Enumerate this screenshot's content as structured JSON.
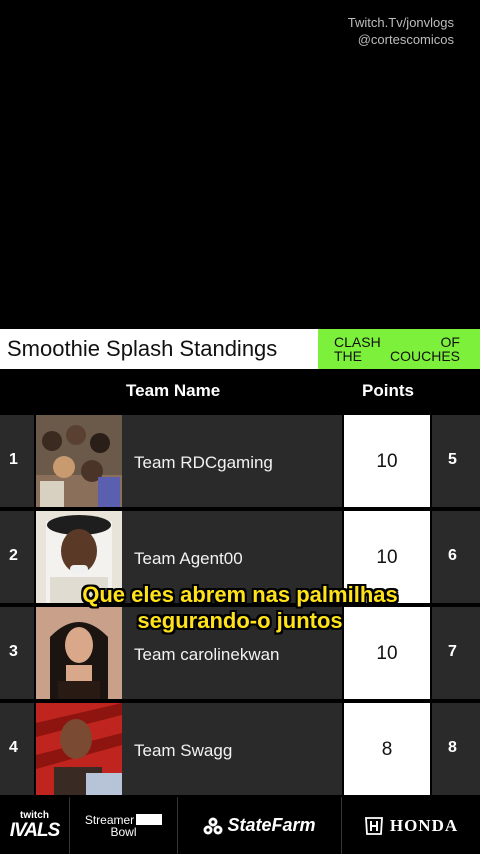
{
  "watermark": {
    "line1": "Twitch.Tv/jonvlogs",
    "line2": "@cortescomicos"
  },
  "header": {
    "title": "Smoothie Splash Standings",
    "badge": {
      "w1": "CLASH",
      "w2": "OF",
      "w3": "THE",
      "w4": "COUCHES"
    }
  },
  "columns": {
    "team": "Team Name",
    "points": "Points"
  },
  "rows": [
    {
      "rank": "1",
      "team": "Team RDCgaming",
      "points": "10",
      "next": "5"
    },
    {
      "rank": "2",
      "team": "Team Agent00",
      "points": "10",
      "next": "6"
    },
    {
      "rank": "3",
      "team": "Team carolinekwan",
      "points": "10",
      "next": "7"
    },
    {
      "rank": "4",
      "team": "Team Swagg",
      "points": "8",
      "next": "8"
    }
  ],
  "caption": {
    "line1": "Que eles abrem nas palmilhas",
    "line2": "segurando-o juntos"
  },
  "sponsors": {
    "rivals_top": "twitch",
    "rivals_big": "IVALS",
    "bowl_top": "Streamer",
    "bowl_bottom": "Bowl",
    "statefarm": "StateFarm",
    "honda": "HONDA"
  },
  "colors": {
    "accent": "#7cf03a",
    "caption": "#ffe21a",
    "row_bg": "#2a2a2a"
  }
}
